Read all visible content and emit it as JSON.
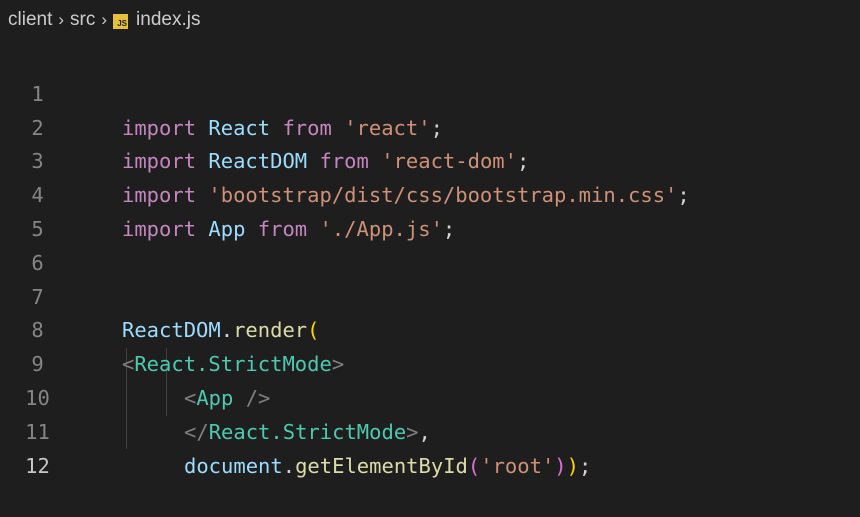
{
  "breadcrumb": {
    "segments": [
      "client",
      "src"
    ],
    "file_badge": "JS",
    "file_name": "index.js",
    "separator": "›"
  },
  "line_numbers": [
    "1",
    "2",
    "3",
    "4",
    "5",
    "6",
    "7",
    "8",
    "9",
    "10",
    "11",
    "12"
  ],
  "code": {
    "l1": {
      "import": "import",
      "name": "React",
      "from": "from",
      "source": "'react'",
      "semi": ";"
    },
    "l2": {
      "import": "import",
      "name": "ReactDOM",
      "from": "from",
      "source": "'react-dom'",
      "semi": ";"
    },
    "l3": {
      "import": "import",
      "source": "'bootstrap/dist/css/bootstrap.min.css'",
      "semi": ";"
    },
    "l4": {
      "import": "import",
      "name": "App",
      "from": "from",
      "source": "'./App.js'",
      "semi": ";"
    },
    "l7": {
      "object": "ReactDOM",
      "dot": ".",
      "method": "render",
      "paren": "("
    },
    "l8": {
      "open": "<",
      "tag": "React.StrictMode",
      "close": ">"
    },
    "l9": {
      "open": "<",
      "tag": "App",
      "close": " />"
    },
    "l10": {
      "open": "</",
      "tag": "React.StrictMode",
      "close": ">",
      "comma": ","
    },
    "l11": {
      "object": "document",
      "dot": ".",
      "method": "getElementById",
      "paren_open": "(",
      "arg": "'root'",
      "paren_close": ")",
      "outer_close": ")",
      "semi": ";"
    }
  },
  "colors": {
    "background": "#1e1e1e",
    "keyword": "#c586c0",
    "identifier": "#9cdcfe",
    "string": "#ce9178",
    "function": "#dcdcaa",
    "tag": "#4ec9b0",
    "bracket_level1": "#ffd700",
    "bracket_level2": "#da70d6",
    "js_badge": "#e5c13b"
  }
}
